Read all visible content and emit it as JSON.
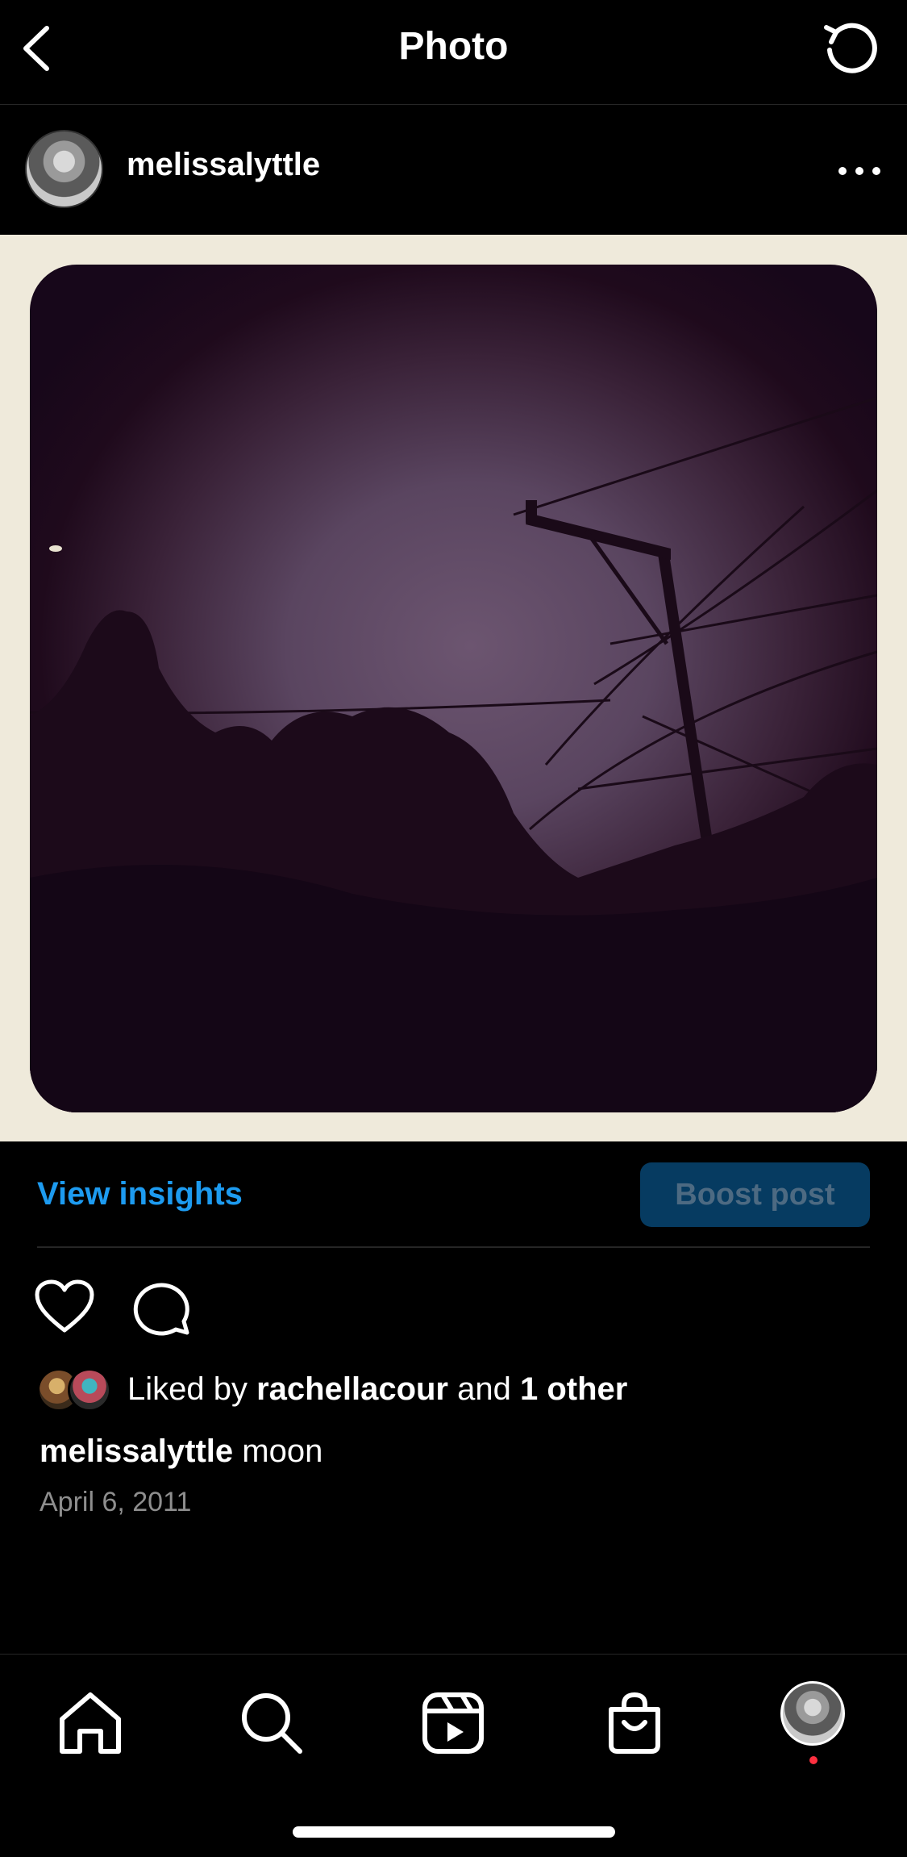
{
  "header": {
    "title": "Photo"
  },
  "post": {
    "username": "melissalyttle",
    "caption_user": "melissalyttle",
    "caption_text": "moon",
    "date": "April 6, 2011"
  },
  "insights": {
    "view_insights": "View insights",
    "boost": "Boost post"
  },
  "likes": {
    "prefix": "Liked by ",
    "user": "rachellacour",
    "middle": " and ",
    "other": "1 other"
  },
  "tabbar": {
    "items": [
      "home-icon",
      "search-icon",
      "reels-icon",
      "shop-icon",
      "profile-avatar"
    ]
  },
  "colors": {
    "link_blue": "#1d9bf0",
    "boost_bg": "#063b61",
    "notification_dot": "#ff3040"
  }
}
